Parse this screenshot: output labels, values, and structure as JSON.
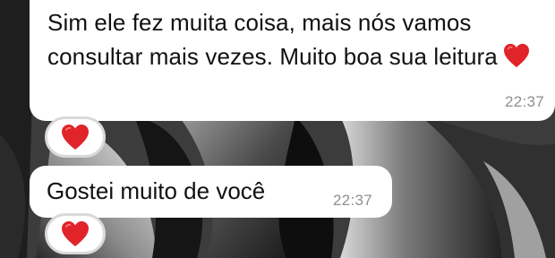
{
  "messages": [
    {
      "text": "Sim ele fez muita coisa, mais nós vamos consultar mais vezes. Muito boa sua leitura",
      "trailing_emoji": "heart-icon",
      "time": "22:37",
      "reaction": "heart-icon"
    },
    {
      "text": "Gostei muito de você",
      "time": "22:37",
      "reaction": "heart-icon"
    }
  ],
  "colors": {
    "bubble": "#ffffff",
    "heart": "#e0242a",
    "timestamp": "#8e8e93",
    "reaction_border": "#d9d9d9"
  }
}
